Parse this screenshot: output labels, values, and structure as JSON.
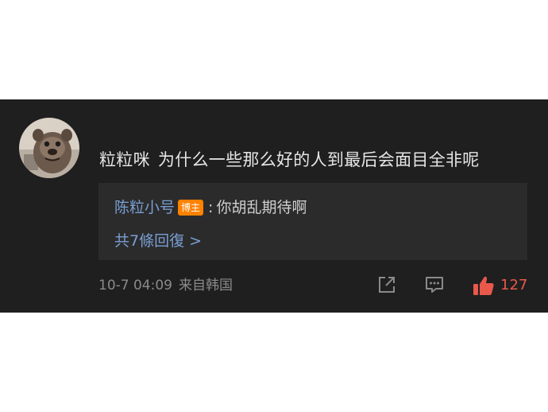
{
  "comment": {
    "username": "粒粒咪",
    "text": "为什么一些那么好的人到最后会面目全非呢"
  },
  "reply_preview": {
    "username": "陈粒小号",
    "badge": "博主",
    "separator": ":",
    "text": "你胡乱期待啊",
    "more_link": "共7條回復 >"
  },
  "meta": {
    "time": "10-7 04:09",
    "location": "来自韩国"
  },
  "actions": {
    "like_count": "127"
  },
  "colors": {
    "background": "#1f1f1f",
    "reply_bg": "#2b2b2b",
    "link": "#7a9fd4",
    "badge": "#ff8200",
    "like": "#e8584b"
  },
  "icons": [
    "avatar-image",
    "share-icon",
    "comment-icon",
    "thumbs-up-icon"
  ]
}
